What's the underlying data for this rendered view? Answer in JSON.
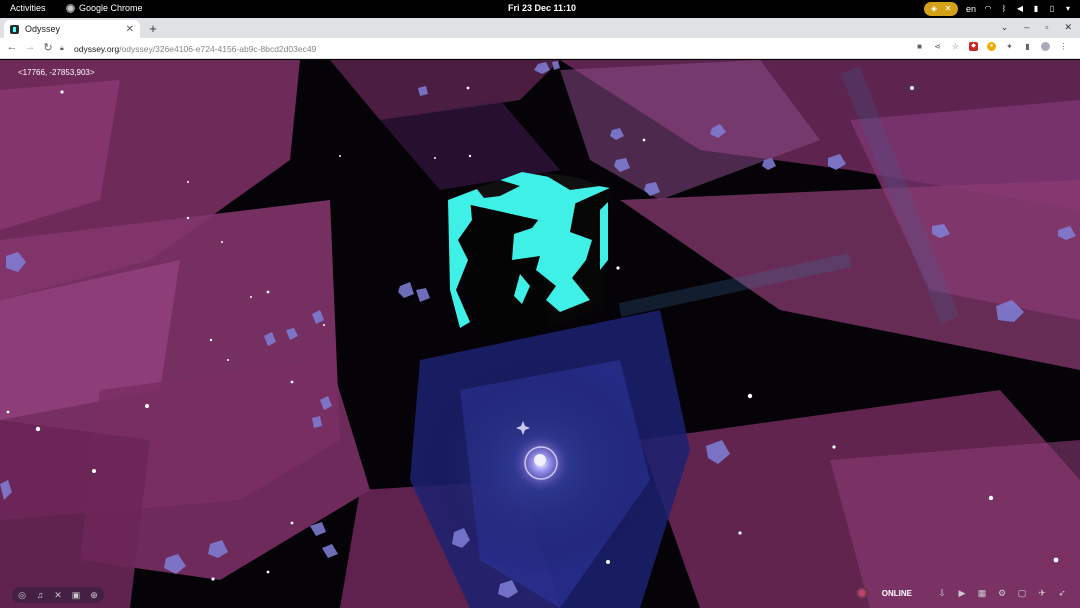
{
  "topbar": {
    "activities": "Activities",
    "app_name": "Google Chrome",
    "clock": "Fri 23 Dec  11:10",
    "lang": "en"
  },
  "browser": {
    "tab_title": "Odyssey",
    "url_host": "odyssey.org",
    "url_path": "/odyssey/326e4106-e724-4156-ab9c-8bcd2d03ec49"
  },
  "scene": {
    "coords": "<17766, -27853,903>",
    "cube_color": "#4ff0e8",
    "panel_color": "#9c3c78",
    "accent": "#7070d0"
  },
  "bottom": {
    "status": "ONLINE"
  }
}
